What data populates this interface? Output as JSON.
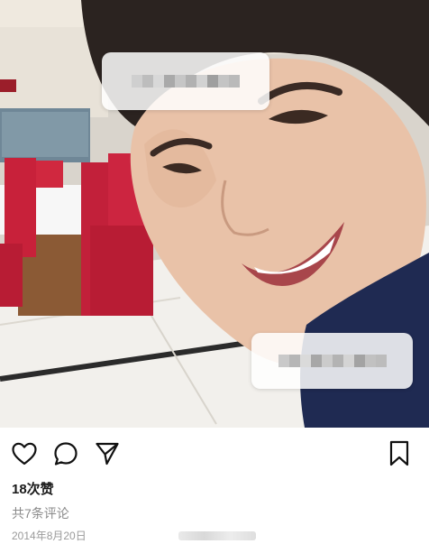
{
  "post": {
    "image_alt": "",
    "likes_label": "18次赞",
    "comments_label": "共7条评论",
    "date_label": "2014年8月20日"
  },
  "icons": {
    "like": "heart-icon",
    "comment": "comment-bubble-icon",
    "share": "paper-plane-icon",
    "save": "bookmark-icon"
  },
  "colors": {
    "chair_red": "#c8213a",
    "text_dark": "#1a1a1a",
    "text_muted": "#8a8a8a"
  }
}
